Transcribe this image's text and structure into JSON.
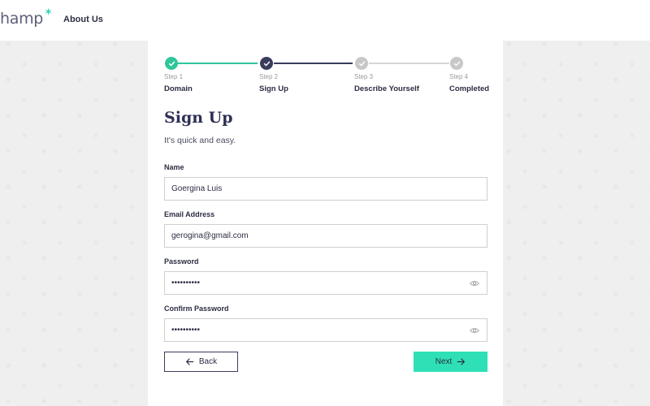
{
  "header": {
    "logo_text": "hamp",
    "logo_star": "✶",
    "nav_about": "About Us"
  },
  "stepper": {
    "steps": [
      {
        "num": "Step 1",
        "name": "Domain",
        "state": "done"
      },
      {
        "num": "Step 2",
        "name": "Sign Up",
        "state": "active"
      },
      {
        "num": "Step 3",
        "name": "Describe Yourself",
        "state": "pending"
      },
      {
        "num": "Step 4",
        "name": "Completed",
        "state": "pending"
      }
    ]
  },
  "form": {
    "title": "Sign Up",
    "subtitle": "It's quick and easy.",
    "name_label": "Name",
    "name_value": "Goergina Luis",
    "email_label": "Email Address",
    "email_value": "gerogina@gmail.com",
    "password_label": "Password",
    "password_value": "••••••••••",
    "confirm_label": "Confirm Password",
    "confirm_value": "••••••••••"
  },
  "buttons": {
    "back": "Back",
    "next": "Next"
  },
  "colors": {
    "accent": "#2fe0b6",
    "done": "#2fc69b",
    "active": "#3a3c5c",
    "pending": "#c8c8c8"
  },
  "icons": {
    "check": "check-icon",
    "eye": "eye-icon",
    "arrow_left": "arrow-left-icon",
    "arrow_right": "arrow-right-icon"
  }
}
